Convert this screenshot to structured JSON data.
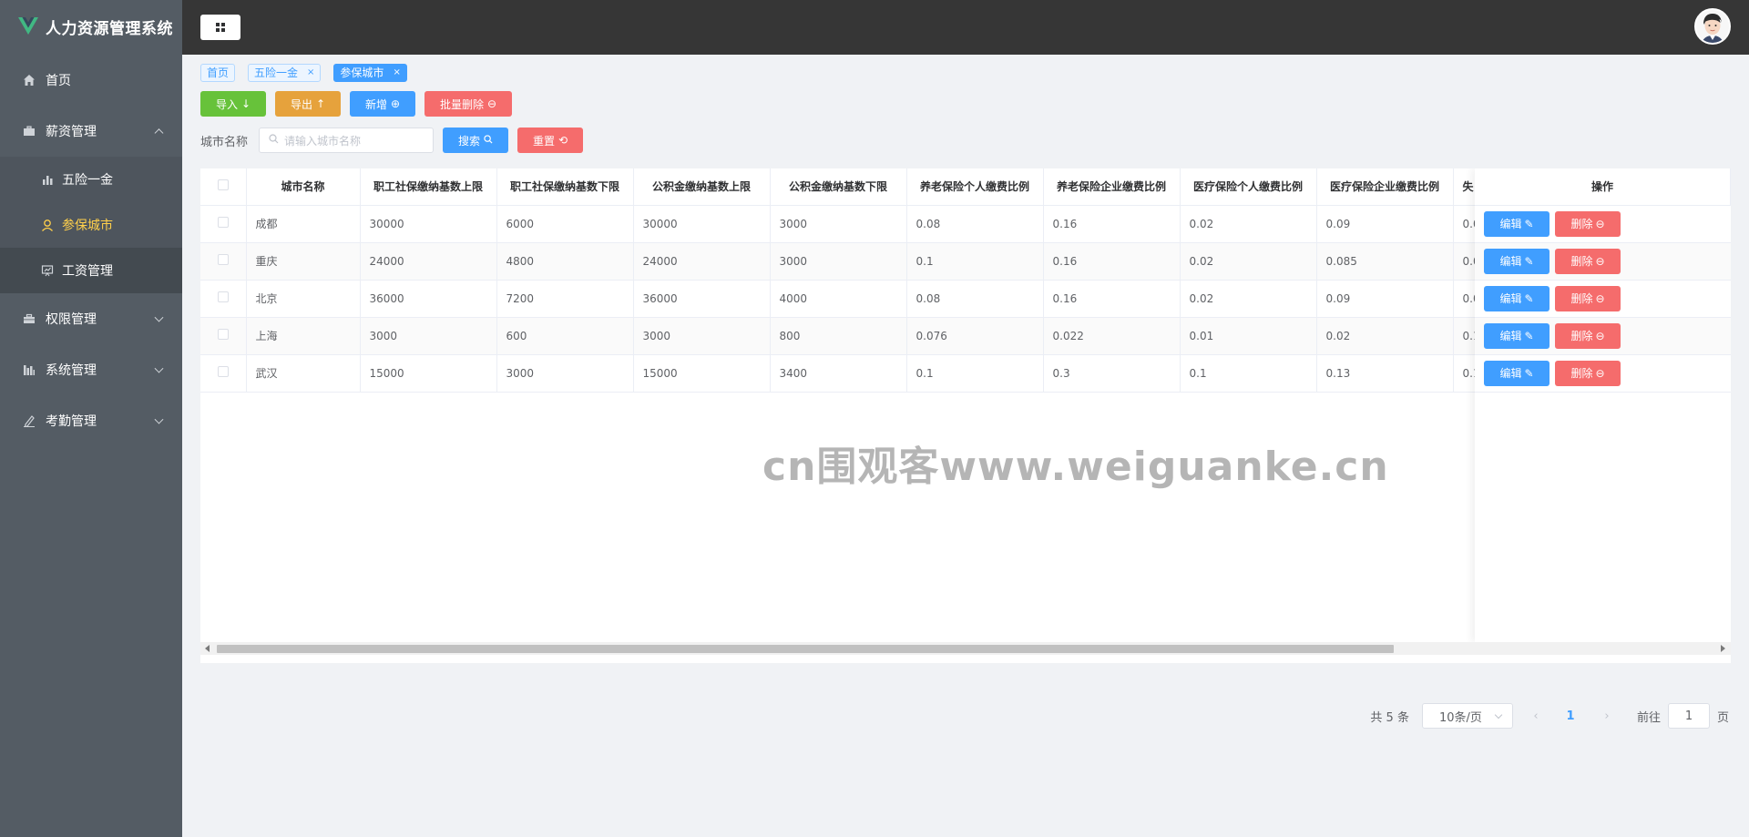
{
  "app": {
    "title": "人力资源管理系统"
  },
  "sidebar": {
    "items": [
      {
        "label": "首页",
        "icon": "home-icon"
      },
      {
        "label": "薪资管理",
        "icon": "briefcase-icon",
        "expanded": true,
        "children": [
          {
            "label": "五险一金",
            "icon": "bar-chart-icon",
            "active": false
          },
          {
            "label": "参保城市",
            "icon": "user-icon",
            "active": true
          },
          {
            "label": "工资管理",
            "icon": "presentation-icon",
            "active": false
          }
        ]
      },
      {
        "label": "权限管理",
        "icon": "suitcase-icon"
      },
      {
        "label": "系统管理",
        "icon": "chart-bars-icon"
      },
      {
        "label": "考勤管理",
        "icon": "pen-icon"
      }
    ],
    "colors": {
      "bg": "#545c64",
      "active_text": "#ffd04b"
    }
  },
  "tags": [
    {
      "label": "首页",
      "closable": false,
      "active": false
    },
    {
      "label": "五险一金",
      "closable": true,
      "active": false
    },
    {
      "label": "参保城市",
      "closable": true,
      "active": true
    }
  ],
  "toolbar": {
    "import_label": "导入",
    "export_label": "导出",
    "add_label": "新增",
    "batch_delete_label": "批量删除"
  },
  "search": {
    "label": "城市名称",
    "placeholder": "请输入城市名称",
    "search_label": "搜索",
    "reset_label": "重置"
  },
  "table": {
    "columns": [
      "城市名称",
      "职工社保缴纳基数上限",
      "职工社保缴纳基数下限",
      "公积金缴纳基数上限",
      "公积金缴纳基数下限",
      "养老保险个人缴费比例",
      "养老保险企业缴费比例",
      "医疗保险个人缴费比例",
      "医疗保险企业缴费比例",
      "失"
    ],
    "ops_header": "操作",
    "edit_label": "编辑",
    "delete_label": "删除",
    "rows": [
      [
        "成都",
        "30000",
        "6000",
        "30000",
        "3000",
        "0.08",
        "0.16",
        "0.02",
        "0.09",
        "0.0"
      ],
      [
        "重庆",
        "24000",
        "4800",
        "24000",
        "3000",
        "0.1",
        "0.16",
        "0.02",
        "0.085",
        "0.0"
      ],
      [
        "北京",
        "36000",
        "7200",
        "36000",
        "4000",
        "0.08",
        "0.16",
        "0.02",
        "0.09",
        "0.0"
      ],
      [
        "上海",
        "3000",
        "600",
        "3000",
        "800",
        "0.076",
        "0.022",
        "0.01",
        "0.02",
        "0.1"
      ],
      [
        "武汉",
        "15000",
        "3000",
        "15000",
        "3400",
        "0.1",
        "0.3",
        "0.1",
        "0.13",
        "0.1"
      ]
    ]
  },
  "pagination": {
    "total_text": "共 5 条",
    "page_size": "10条/页",
    "current_page": "1",
    "goto_prefix": "前往",
    "goto_value": "1",
    "goto_suffix": "页"
  },
  "watermark": "cn围观客www.weiguanke.cn"
}
